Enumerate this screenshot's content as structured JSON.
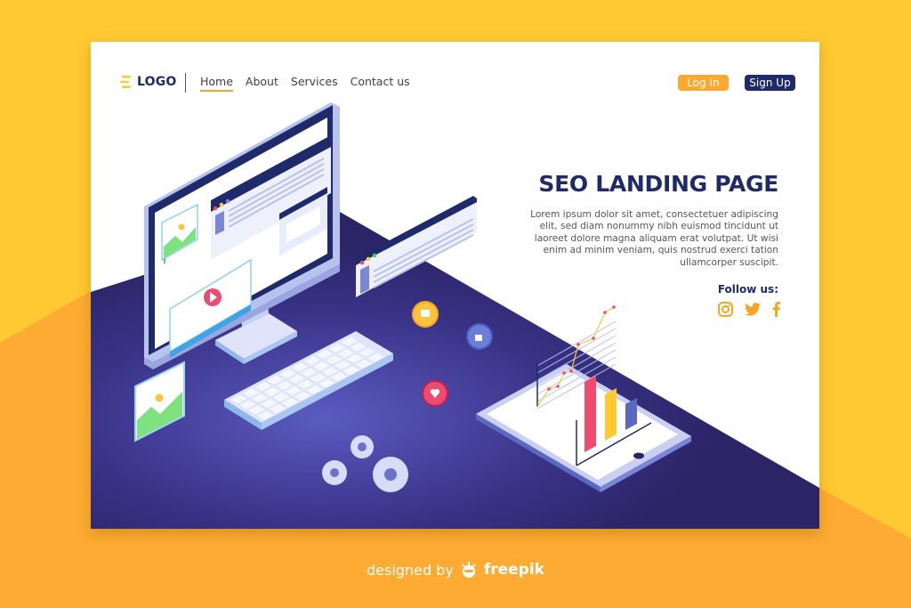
{
  "colors": {
    "bg_yellow": "#fec932",
    "bg_orange": "#fdab32",
    "navy": "#1f2a6b",
    "accent": "#f6a623",
    "desk_purple": "#2b2466",
    "desk_glow": "#5b5bc0"
  },
  "nav": {
    "logo": "LOGO",
    "links": [
      "Home",
      "About",
      "Services",
      "Contact us"
    ],
    "active": "Home",
    "login": "Log In",
    "signup": "Sign Up"
  },
  "hero": {
    "title": "SEO LANDING PAGE",
    "body": "Lorem ipsum dolor sit amet, consectetuer adipiscing elit, sed diam nonummy nibh euismod tincidunt ut laoreet dolore magna aliquam erat volutpat. Ut wisi enim ad minim veniam, quis nostrud exerci tation ullamcorper suscipit.",
    "follow": "Follow us:",
    "social": [
      "instagram",
      "twitter",
      "facebook"
    ]
  },
  "footer": {
    "text": "designed by",
    "brand": "freepik"
  }
}
